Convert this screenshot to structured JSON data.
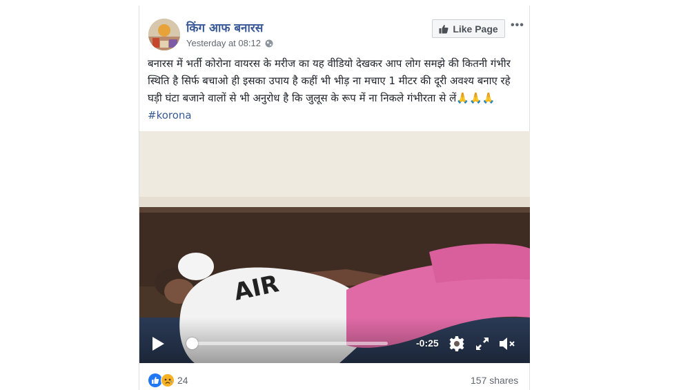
{
  "post": {
    "page_name": "किंग आफ बनारस",
    "timestamp": "Yesterday at 08:12",
    "like_page_label": "Like Page",
    "more_label": "•••",
    "text_body": "बनारस में भर्ती कोरोना वायरस के मरीज का यह वीडियो देखकर आप लोग समझे की कितनी गंभीर स्थिति है सिर्फ बचाओ ही इसका उपाय है कहीं भी भीड़ ना मचाए 1 मीटर की दूरी अवश्य बनाए रहे घड़ी घंटा बजाने वालों से भी अनुरोध है कि जुलूस के रूप में ना निकले गंभीरता से लें🙏🙏🙏 ",
    "hashtag": "#korona"
  },
  "video": {
    "time_remaining": "-0:25",
    "progress_fraction": 0.02,
    "shirt_text": "AIR"
  },
  "footer": {
    "reaction_count": "24",
    "shares_label": "157 shares",
    "reaction_icons": [
      "like-icon",
      "sad-icon"
    ]
  },
  "colors": {
    "link": "#385898",
    "pants": "#e06aa6",
    "wall": "#efeadf",
    "headboard": "#3e2c22"
  }
}
